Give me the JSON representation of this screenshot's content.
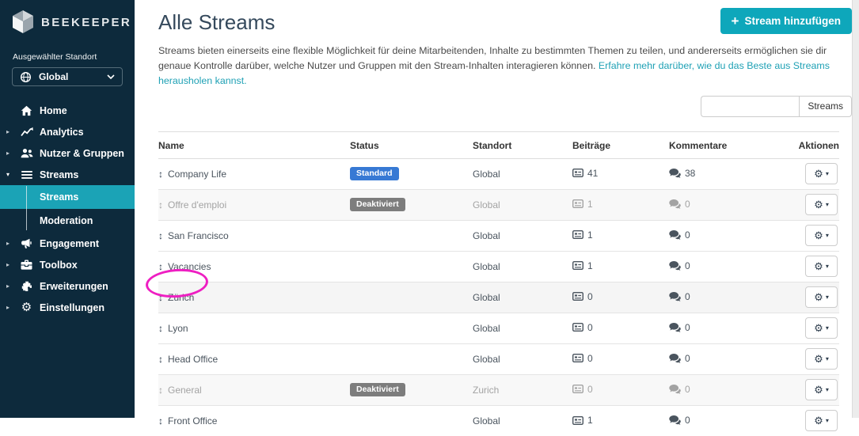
{
  "sidebar": {
    "logo_text": "BEEKEEPER",
    "location_label": "Ausgewählter Standort",
    "location": {
      "selected": "Global"
    },
    "nav": [
      {
        "label": "Home"
      },
      {
        "label": "Analytics"
      },
      {
        "label": "Nutzer & Gruppen"
      },
      {
        "label": "Streams",
        "children": [
          {
            "label": "Streams"
          },
          {
            "label": "Moderation"
          }
        ]
      },
      {
        "label": "Engagement"
      },
      {
        "label": "Toolbox"
      },
      {
        "label": "Erweiterungen"
      },
      {
        "label": "Einstellungen"
      }
    ]
  },
  "header": {
    "title": "Alle Streams",
    "add_button_label": "Stream hinzufügen"
  },
  "description": {
    "text": "Streams bieten einerseits eine flexible Möglichkeit für deine Mitarbeitenden, Inhalte zu bestimmten Themen zu teilen, und andererseits ermöglichen sie dir genaue Kontrolle darüber, welche Nutzer und Gruppen mit den Stream-Inhalten interagieren können. ",
    "link_text": "Erfahre mehr darüber, wie du das Beste aus Streams herausholen kannst."
  },
  "search": {
    "value": "",
    "placeholder": "",
    "button_label": "Streams"
  },
  "table": {
    "columns": [
      "Name",
      "Status",
      "Standort",
      "Beiträge",
      "Kommentare",
      "Aktionen"
    ],
    "rows": [
      {
        "name": "Company Life",
        "status": "Standard",
        "standort": "Global",
        "beitraege": "41",
        "kommentare": "38"
      },
      {
        "name": "Offre d'emploi",
        "status": "Deaktiviert",
        "standort": "Global",
        "beitraege": "1",
        "kommentare": "0"
      },
      {
        "name": "San Francisco",
        "status": "",
        "standort": "Global",
        "beitraege": "1",
        "kommentare": "0"
      },
      {
        "name": "Vacancies",
        "status": "",
        "standort": "Global",
        "beitraege": "1",
        "kommentare": "0"
      },
      {
        "name": "Zürich",
        "status": "",
        "standort": "Global",
        "beitraege": "0",
        "kommentare": "0"
      },
      {
        "name": "Lyon",
        "status": "",
        "standort": "Global",
        "beitraege": "0",
        "kommentare": "0"
      },
      {
        "name": "Head Office",
        "status": "",
        "standort": "Global",
        "beitraege": "0",
        "kommentare": "0"
      },
      {
        "name": "General",
        "status": "Deaktiviert",
        "standort": "Zurich",
        "beitraege": "0",
        "kommentare": "0"
      },
      {
        "name": "Front Office",
        "status": "",
        "standort": "Global",
        "beitraege": "1",
        "kommentare": "0"
      }
    ]
  },
  "icons": {
    "plus": "+",
    "gear": "⚙",
    "caret_right": "▸",
    "caret_down": "▾",
    "drag": "↕"
  },
  "colors": {
    "sidebar_bg": "#0d2a3c",
    "active_nav_teal": "#1ba3b6",
    "accent_teal": "#0ea7bb",
    "link_teal": "#1fa1b5",
    "badge_blue": "#3779d4",
    "badge_gray": "#7d7d7d",
    "annotation_pink": "#ee1fc2"
  }
}
